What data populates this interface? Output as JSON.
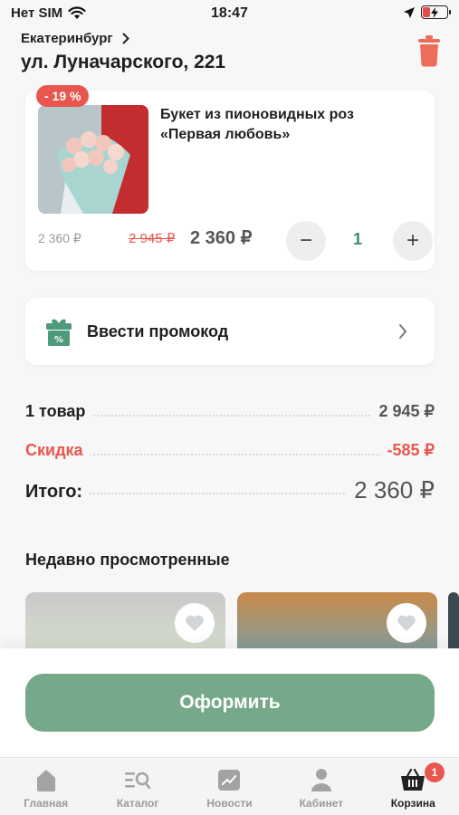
{
  "status_bar": {
    "carrier": "Нет SIM",
    "time": "18:47",
    "battery_level": 0.3
  },
  "location": {
    "city": "Екатеринбург",
    "address": "ул. Луначарского, 221"
  },
  "cart_item": {
    "discount_badge": "- 19 %",
    "title": "Букет из пионовидных роз «Первая любовь»",
    "unit_price": "2 360 ₽",
    "old_price": "2 945 ₽",
    "new_price": "2 360 ₽",
    "minus_label": "−",
    "plus_label": "+",
    "quantity": "1"
  },
  "promo": {
    "label": "Ввести промокод"
  },
  "summary": {
    "items_label": "1 товар",
    "items_value": "2 945 ₽",
    "discount_label": "Скидка",
    "discount_value": "-585 ₽",
    "total_label": "Итого:",
    "total_value": "2 360 ₽"
  },
  "recent": {
    "title": "Недавно просмотренные"
  },
  "checkout": {
    "button_label": "Оформить"
  },
  "tabbar": {
    "tabs": [
      {
        "label": "Главная",
        "icon": "home-icon"
      },
      {
        "label": "Каталог",
        "icon": "catalog-icon"
      },
      {
        "label": "Новости",
        "icon": "news-icon"
      },
      {
        "label": "Кабинет",
        "icon": "profile-icon"
      },
      {
        "label": "Корзина",
        "icon": "cart-icon"
      }
    ],
    "cart_count": "1"
  },
  "colors": {
    "accent_green": "#76a88a",
    "discount_red": "#e8574f",
    "quantity_green": "#3b8a6d"
  }
}
